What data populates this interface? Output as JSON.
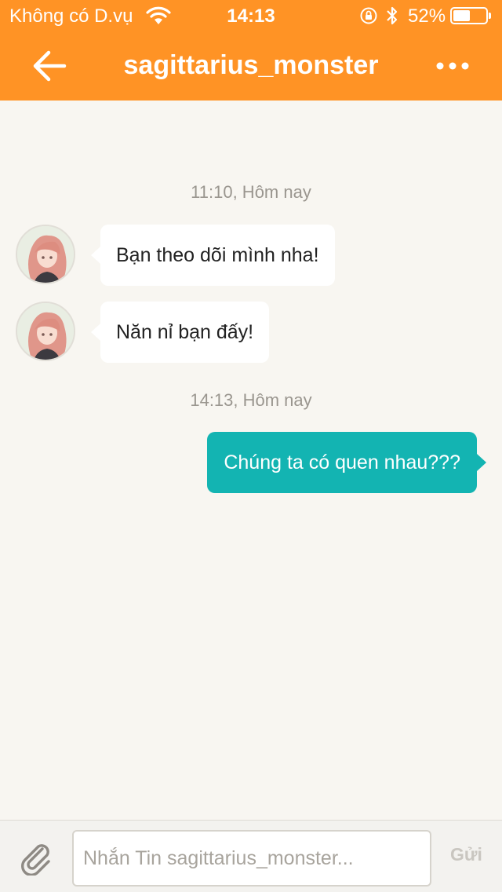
{
  "status_bar": {
    "carrier": "Không có D.vụ",
    "time": "14:13",
    "battery_percent": "52%",
    "battery_level": 0.52,
    "icons": [
      "wifi-icon",
      "rotation-lock-icon",
      "bluetooth-icon",
      "battery-icon"
    ]
  },
  "header": {
    "title": "sagittarius_monster",
    "back_icon": "arrow-left-icon",
    "more_icon": "more-dots-icon",
    "background_color": "#ff9325"
  },
  "messages": {
    "groups": [
      {
        "timestamp": "11:10, Hôm nay",
        "items": [
          {
            "direction": "incoming",
            "text": "Bạn theo dõi mình nha!"
          },
          {
            "direction": "incoming",
            "text": "Năn nỉ bạn đấy!"
          }
        ]
      },
      {
        "timestamp": "14:13, Hôm nay",
        "items": [
          {
            "direction": "outgoing",
            "text": "Chúng ta có quen nhau???"
          }
        ]
      }
    ],
    "outgoing_color": "#13b4b2",
    "incoming_color": "#ffffff"
  },
  "composer": {
    "attach_icon": "paperclip-icon",
    "placeholder": "Nhắn Tin sagittarius_monster...",
    "value": "",
    "send_label": "Gửi"
  }
}
